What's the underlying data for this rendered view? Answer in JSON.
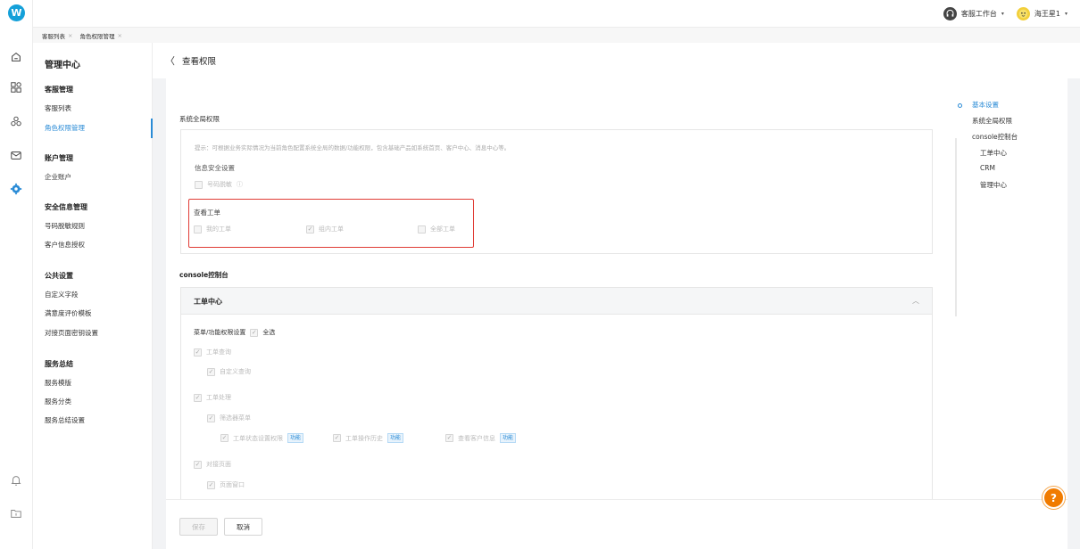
{
  "app": {
    "logo_letter": "W"
  },
  "topbar": {
    "workspace_label": "客服工作台",
    "user_label": "海王星1",
    "caret": "▾"
  },
  "tabs": [
    {
      "label": "客服列表",
      "close": "×"
    },
    {
      "label": "角色权限管理",
      "close": "×"
    }
  ],
  "sidebar": {
    "title": "管理中心",
    "sections": [
      {
        "title": "客服管理",
        "items": [
          "客服列表",
          "角色权限管理"
        ]
      },
      {
        "title": "账户管理",
        "items": [
          "企业账户"
        ]
      },
      {
        "title": "安全信息管理",
        "items": [
          "号码脱敏规则",
          "客户信息授权"
        ]
      },
      {
        "title": "公共设置",
        "items": [
          "自定义字段",
          "满意度评价模板",
          "对接页面密钥设置"
        ]
      },
      {
        "title": "服务总结",
        "items": [
          "服务模版",
          "服务分类",
          "服务总结设置"
        ]
      }
    ],
    "active_item": "角色权限管理"
  },
  "page": {
    "back": "〈",
    "title": "查看权限"
  },
  "global": {
    "section_title": "系统全局权限",
    "hint": "提示：可根据业务实际情况为当前角色配置系统全局的数据/功能权限，包含基础产品如系统首页、客户中心、消息中心等。",
    "info_security": {
      "title": "信息安全设置",
      "option": "号码脱敏",
      "info_icon": "ⓘ"
    },
    "view_tickets": {
      "title": "查看工单",
      "options": [
        {
          "label": "我的工单",
          "checked": false
        },
        {
          "label": "组内工单",
          "checked": true
        },
        {
          "label": "全部工单",
          "checked": false
        }
      ]
    }
  },
  "console": {
    "section_title": "console控制台",
    "panel_title": "工单中心",
    "collapse": "︿",
    "menu_label": "菜单/功能权限设置",
    "select_all": "全选",
    "tree": {
      "query": "工单查询",
      "custom_query": "自定义查询",
      "process": "工单处理",
      "filter_menu": "筛选器菜单",
      "status_perm": "工单状态设置权限",
      "history": "工单操作历史",
      "customer_info": "查看客户信息",
      "tag": "功能",
      "dock_page": "对接页面",
      "page_popup": "页面窗口"
    },
    "check": "✓"
  },
  "footer": {
    "save": "保存",
    "cancel": "取消"
  },
  "anchor": {
    "items": [
      "基本设置",
      "系统全局权限",
      "console控制台",
      "工单中心",
      "CRM",
      "管理中心"
    ]
  },
  "help": {
    "label": "?"
  },
  "colors": {
    "primary": "#2a8bd6",
    "logo": "#14a0d9",
    "highlight_box": "#e03c35",
    "help": "#f07b00"
  }
}
